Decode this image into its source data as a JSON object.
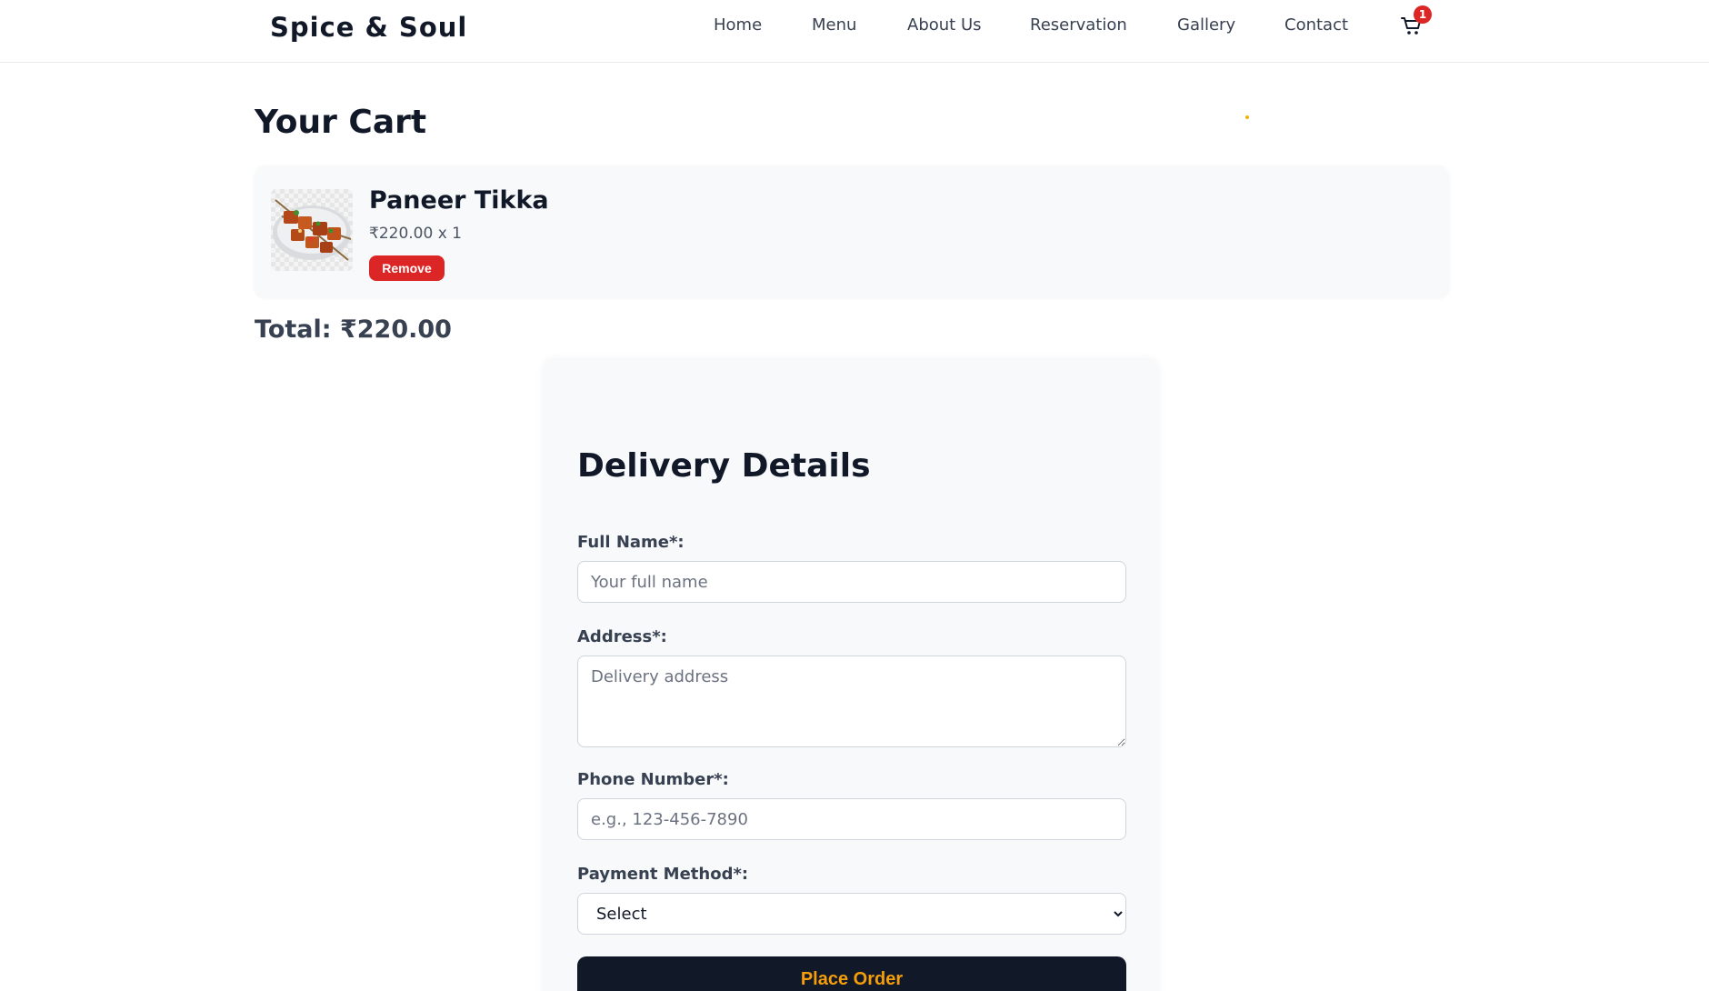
{
  "nav": {
    "brand": "Spice & Soul",
    "links": [
      "Home",
      "Menu",
      "About Us",
      "Reservation",
      "Gallery",
      "Contact"
    ],
    "cart_count": "1",
    "cart_icon": "cart-icon"
  },
  "cart": {
    "title": "Your Cart",
    "items": [
      {
        "name": "Paneer Tikka",
        "price_qty": "₹220.00 x 1",
        "remove_label": "Remove",
        "image": "paneer-tikka-image"
      }
    ],
    "total": "Total: ₹220.00"
  },
  "delivery": {
    "title": "Delivery Details",
    "full_name_label": "Full Name*:",
    "full_name_placeholder": "Your full name",
    "address_label": "Address*:",
    "address_placeholder": "Delivery address",
    "phone_label": "Phone Number*:",
    "phone_placeholder": "e.g., 123-456-7890",
    "payment_label": "Payment Method*:",
    "payment_selected": "Select",
    "submit_label": "Place Order"
  },
  "colors": {
    "accent": "#f59e0b",
    "danger": "#dc2626",
    "dark": "#111827"
  }
}
